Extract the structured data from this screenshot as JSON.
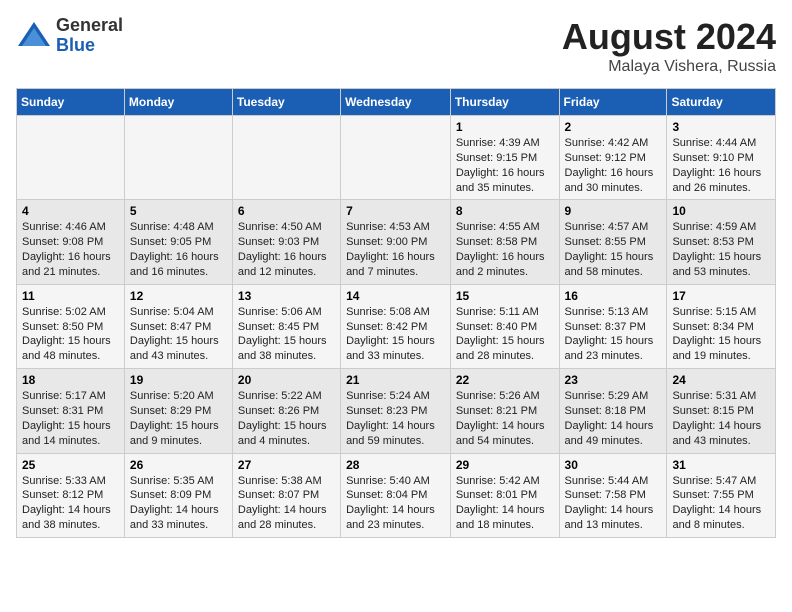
{
  "logo": {
    "general": "General",
    "blue": "Blue"
  },
  "title": "August 2024",
  "subtitle": "Malaya Vishera, Russia",
  "headers": [
    "Sunday",
    "Monday",
    "Tuesday",
    "Wednesday",
    "Thursday",
    "Friday",
    "Saturday"
  ],
  "weeks": [
    [
      {
        "day": "",
        "info": ""
      },
      {
        "day": "",
        "info": ""
      },
      {
        "day": "",
        "info": ""
      },
      {
        "day": "",
        "info": ""
      },
      {
        "day": "1",
        "info": "Sunrise: 4:39 AM\nSunset: 9:15 PM\nDaylight: 16 hours\nand 35 minutes."
      },
      {
        "day": "2",
        "info": "Sunrise: 4:42 AM\nSunset: 9:12 PM\nDaylight: 16 hours\nand 30 minutes."
      },
      {
        "day": "3",
        "info": "Sunrise: 4:44 AM\nSunset: 9:10 PM\nDaylight: 16 hours\nand 26 minutes."
      }
    ],
    [
      {
        "day": "4",
        "info": "Sunrise: 4:46 AM\nSunset: 9:08 PM\nDaylight: 16 hours\nand 21 minutes."
      },
      {
        "day": "5",
        "info": "Sunrise: 4:48 AM\nSunset: 9:05 PM\nDaylight: 16 hours\nand 16 minutes."
      },
      {
        "day": "6",
        "info": "Sunrise: 4:50 AM\nSunset: 9:03 PM\nDaylight: 16 hours\nand 12 minutes."
      },
      {
        "day": "7",
        "info": "Sunrise: 4:53 AM\nSunset: 9:00 PM\nDaylight: 16 hours\nand 7 minutes."
      },
      {
        "day": "8",
        "info": "Sunrise: 4:55 AM\nSunset: 8:58 PM\nDaylight: 16 hours\nand 2 minutes."
      },
      {
        "day": "9",
        "info": "Sunrise: 4:57 AM\nSunset: 8:55 PM\nDaylight: 15 hours\nand 58 minutes."
      },
      {
        "day": "10",
        "info": "Sunrise: 4:59 AM\nSunset: 8:53 PM\nDaylight: 15 hours\nand 53 minutes."
      }
    ],
    [
      {
        "day": "11",
        "info": "Sunrise: 5:02 AM\nSunset: 8:50 PM\nDaylight: 15 hours\nand 48 minutes."
      },
      {
        "day": "12",
        "info": "Sunrise: 5:04 AM\nSunset: 8:47 PM\nDaylight: 15 hours\nand 43 minutes."
      },
      {
        "day": "13",
        "info": "Sunrise: 5:06 AM\nSunset: 8:45 PM\nDaylight: 15 hours\nand 38 minutes."
      },
      {
        "day": "14",
        "info": "Sunrise: 5:08 AM\nSunset: 8:42 PM\nDaylight: 15 hours\nand 33 minutes."
      },
      {
        "day": "15",
        "info": "Sunrise: 5:11 AM\nSunset: 8:40 PM\nDaylight: 15 hours\nand 28 minutes."
      },
      {
        "day": "16",
        "info": "Sunrise: 5:13 AM\nSunset: 8:37 PM\nDaylight: 15 hours\nand 23 minutes."
      },
      {
        "day": "17",
        "info": "Sunrise: 5:15 AM\nSunset: 8:34 PM\nDaylight: 15 hours\nand 19 minutes."
      }
    ],
    [
      {
        "day": "18",
        "info": "Sunrise: 5:17 AM\nSunset: 8:31 PM\nDaylight: 15 hours\nand 14 minutes."
      },
      {
        "day": "19",
        "info": "Sunrise: 5:20 AM\nSunset: 8:29 PM\nDaylight: 15 hours\nand 9 minutes."
      },
      {
        "day": "20",
        "info": "Sunrise: 5:22 AM\nSunset: 8:26 PM\nDaylight: 15 hours\nand 4 minutes."
      },
      {
        "day": "21",
        "info": "Sunrise: 5:24 AM\nSunset: 8:23 PM\nDaylight: 14 hours\nand 59 minutes."
      },
      {
        "day": "22",
        "info": "Sunrise: 5:26 AM\nSunset: 8:21 PM\nDaylight: 14 hours\nand 54 minutes."
      },
      {
        "day": "23",
        "info": "Sunrise: 5:29 AM\nSunset: 8:18 PM\nDaylight: 14 hours\nand 49 minutes."
      },
      {
        "day": "24",
        "info": "Sunrise: 5:31 AM\nSunset: 8:15 PM\nDaylight: 14 hours\nand 43 minutes."
      }
    ],
    [
      {
        "day": "25",
        "info": "Sunrise: 5:33 AM\nSunset: 8:12 PM\nDaylight: 14 hours\nand 38 minutes."
      },
      {
        "day": "26",
        "info": "Sunrise: 5:35 AM\nSunset: 8:09 PM\nDaylight: 14 hours\nand 33 minutes."
      },
      {
        "day": "27",
        "info": "Sunrise: 5:38 AM\nSunset: 8:07 PM\nDaylight: 14 hours\nand 28 minutes."
      },
      {
        "day": "28",
        "info": "Sunrise: 5:40 AM\nSunset: 8:04 PM\nDaylight: 14 hours\nand 23 minutes."
      },
      {
        "day": "29",
        "info": "Sunrise: 5:42 AM\nSunset: 8:01 PM\nDaylight: 14 hours\nand 18 minutes."
      },
      {
        "day": "30",
        "info": "Sunrise: 5:44 AM\nSunset: 7:58 PM\nDaylight: 14 hours\nand 13 minutes."
      },
      {
        "day": "31",
        "info": "Sunrise: 5:47 AM\nSunset: 7:55 PM\nDaylight: 14 hours\nand 8 minutes."
      }
    ]
  ]
}
